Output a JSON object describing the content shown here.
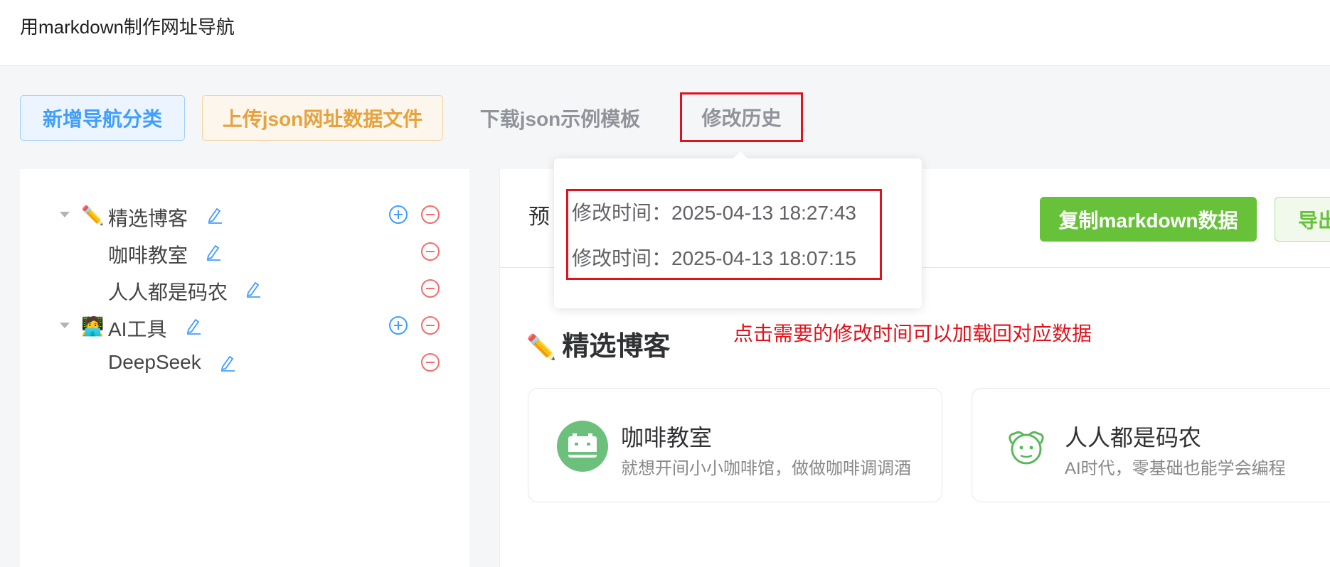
{
  "app": {
    "title": "用markdown制作网址导航"
  },
  "toolbar": {
    "add_category": "新增导航分类",
    "upload_json": "上传json网址数据文件",
    "download_template": "下载json示例模板",
    "history": "修改历史"
  },
  "tree": {
    "items": [
      {
        "emoji": "✏️",
        "label": "精选博客",
        "level": 1
      },
      {
        "label": "咖啡教室",
        "level": 2
      },
      {
        "label": "人人都是码农",
        "level": 2
      },
      {
        "emoji": "🧑‍💻",
        "label": "AI工具",
        "level": 1
      },
      {
        "label": "DeepSeek",
        "level": 2
      }
    ]
  },
  "history": {
    "entries": [
      "修改时间：2025-04-13 18:27:43",
      "修改时间：2025-04-13 18:07:15"
    ]
  },
  "preview": {
    "label": "预",
    "copy_button": "复制markdown数据",
    "export_button": "导出",
    "section_emoji": "✏️",
    "section_title": "精选博客",
    "cards": [
      {
        "title": "咖啡教室",
        "desc": "就想开间小小咖啡馆，做做咖啡调调酒",
        "icon": "coffee-classroom-logo"
      },
      {
        "title": "人人都是码农",
        "desc": "AI时代，零基础也能学会编程",
        "icon": "cartoon-face-logo"
      }
    ]
  },
  "annotation": "点击需要的修改时间可以加载回对应数据",
  "colors": {
    "primary": "#409eff",
    "warning": "#e6a23c",
    "success": "#67c23a",
    "danger": "#f56c6c",
    "highlight": "#e0121c"
  }
}
